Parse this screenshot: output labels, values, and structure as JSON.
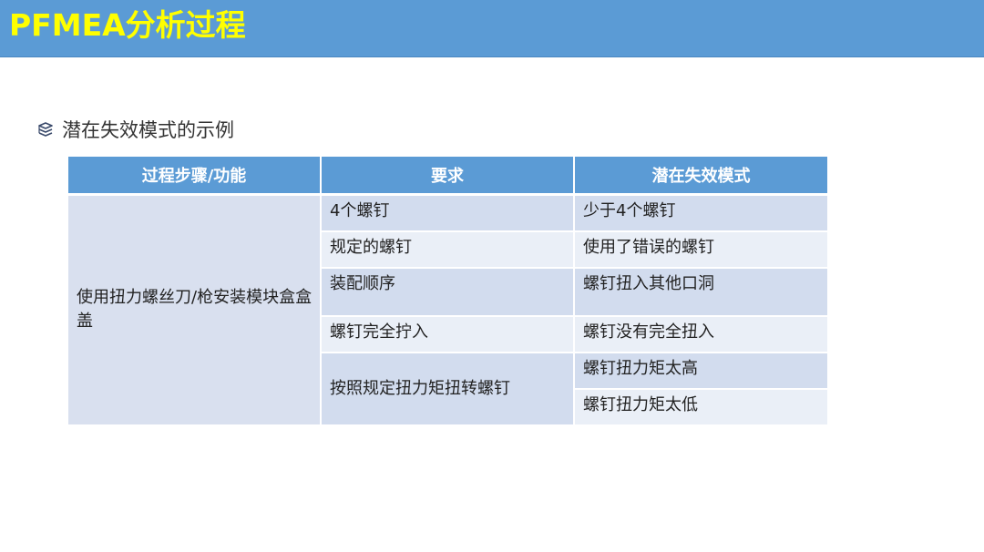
{
  "title": "PFMEA分析过程",
  "subtitle": {
    "icon": "stack-layers-icon",
    "text": "潜在失效模式的示例"
  },
  "colors": {
    "title_bar": "#5b9bd5",
    "title_text": "#ffff00",
    "header": "#5b9bd5",
    "row_dark": "#d2dcee",
    "row_light": "#eaeff7"
  },
  "table": {
    "headers": [
      "过程步骤/功能",
      "要求",
      "潜在失效模式"
    ],
    "process_step": "使用扭力螺丝刀/枪安装模块盒盒盖",
    "rows": [
      {
        "requirement": "4个螺钉",
        "failure_modes": [
          "少于4个螺钉"
        ]
      },
      {
        "requirement": "规定的螺钉",
        "failure_modes": [
          "使用了错误的螺钉"
        ]
      },
      {
        "requirement": "装配顺序",
        "failure_modes": [
          "螺钉扭入其他口洞"
        ]
      },
      {
        "requirement": "螺钉完全拧入",
        "failure_modes": [
          "螺钉没有完全扭入"
        ]
      },
      {
        "requirement": "按照规定扭力矩扭转螺钉",
        "failure_modes": [
          "螺钉扭力矩太高",
          "螺钉扭力矩太低"
        ]
      }
    ]
  }
}
